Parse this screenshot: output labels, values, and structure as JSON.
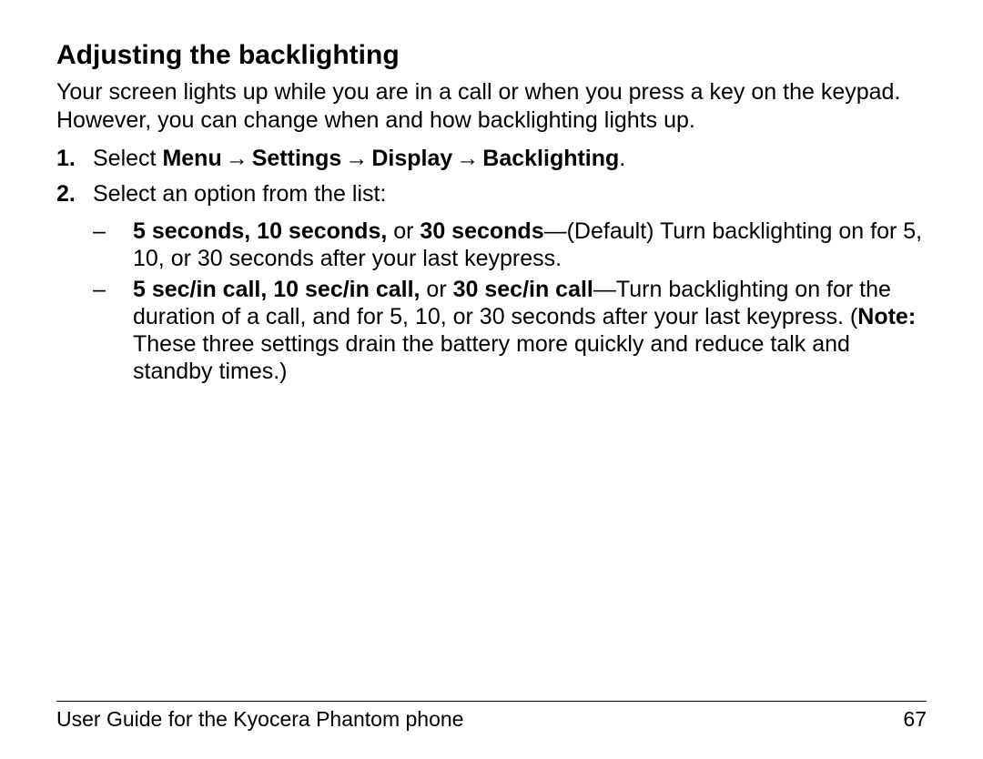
{
  "heading": "Adjusting the backlighting",
  "intro": "Your screen lights up while you are in a call or when you press a key on the keypad. However, you can change when and how backlighting lights up.",
  "steps": {
    "one": {
      "marker": "1.",
      "lead": "Select ",
      "path1": "Menu",
      "path2": "Settings",
      "path3": "Display",
      "path4": "Backlighting",
      "tail": "."
    },
    "two": {
      "marker": "2.",
      "text": "Select an option from the list:"
    }
  },
  "arrow": "→",
  "dash": "–",
  "bullets": {
    "a": {
      "bold1": "5 seconds, 10 seconds,",
      "mid1": " or ",
      "bold2": "30 seconds",
      "rest": "—(Default) Turn backlighting on for 5, 10, or 30 seconds after your last keypress."
    },
    "b": {
      "bold1": "5 sec/in call, 10 sec/in call,",
      "mid1": " or ",
      "bold2": "30 sec/in call",
      "rest1": "—Turn backlighting on for the duration of a call, and for 5, 10, or 30 seconds after your last keypress. (",
      "note_label": "Note:",
      "rest2": " These three settings drain the battery more quickly and reduce talk and standby times.)"
    }
  },
  "footer": {
    "title": "User Guide for the Kyocera Phantom phone",
    "page": "67"
  }
}
